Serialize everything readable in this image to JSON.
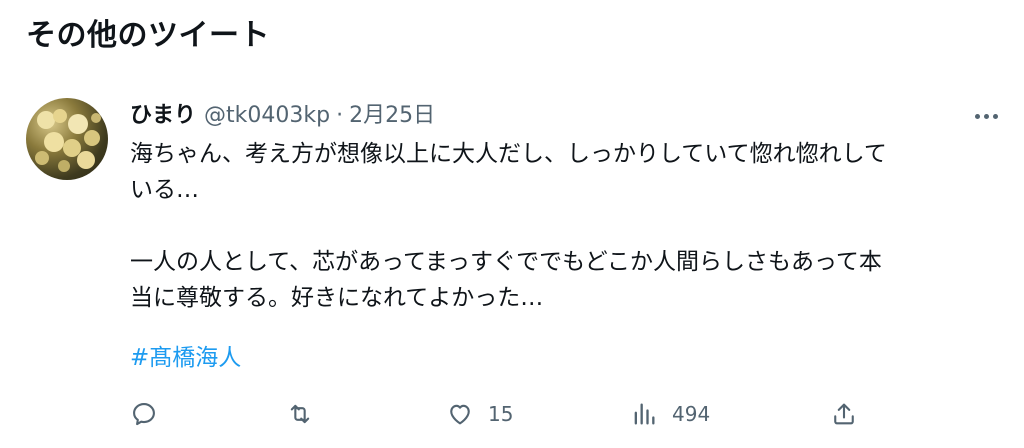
{
  "section": {
    "title": "その他のツイート"
  },
  "tweet": {
    "display_name": "ひまり",
    "handle": "@tk0403kp",
    "separator": "·",
    "date": "2月25日",
    "text_lines": [
      "海ちゃん、考え方が想像以上に大人だし、しっかりしていて惚れ惚れして",
      "いる…",
      "一人の人として、芯があってまっすぐででもどこか人間らしさもあって本",
      "当に尊敬する。好きになれてよかった…"
    ],
    "hashtag": "#髙橋海人",
    "icons": {
      "more": "more-horizontal-icon",
      "reply": "reply-icon",
      "retweet": "retweet-icon",
      "like": "heart-icon",
      "views": "views-icon",
      "share": "share-icon"
    },
    "metrics": {
      "likes": "15",
      "views": "494"
    }
  },
  "colors": {
    "text": "#0f1419",
    "secondary": "#536471",
    "link": "#1d9bf0",
    "background": "#ffffff"
  }
}
